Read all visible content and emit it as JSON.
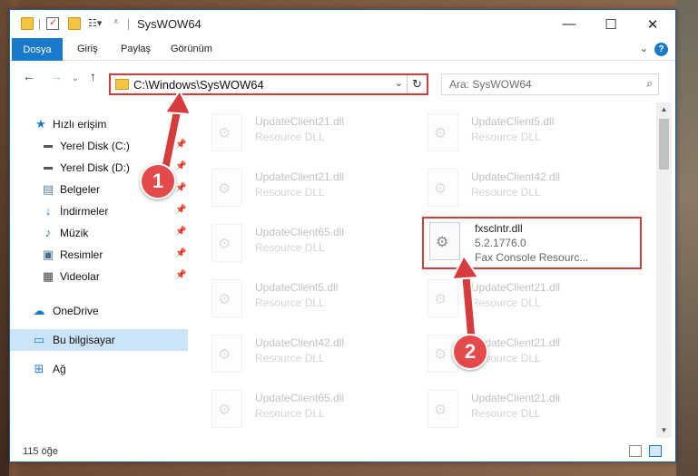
{
  "window": {
    "title": "SysWOW64",
    "minimize_glyph": "—",
    "maximize_glyph": "☐",
    "close_glyph": "✕"
  },
  "ribbon": {
    "file_tab": "Dosya",
    "tabs": [
      "Giriş",
      "Paylaş",
      "Görünüm"
    ],
    "help_glyph": "?"
  },
  "address": {
    "path": "C:\\Windows\\SysWOW64",
    "search_placeholder": "Ara: SysWOW64"
  },
  "nav": {
    "quick_access": "Hızlı erişim",
    "items": [
      {
        "label": "Yerel Disk (C:)",
        "icon": "drive-icon"
      },
      {
        "label": "Yerel Disk (D:)",
        "icon": "drive-icon"
      },
      {
        "label": "Belgeler",
        "icon": "documents-icon"
      },
      {
        "label": "İndirmeler",
        "icon": "downloads-icon"
      },
      {
        "label": "Müzik",
        "icon": "music-icon"
      },
      {
        "label": "Resimler",
        "icon": "pictures-icon"
      },
      {
        "label": "Videolar",
        "icon": "videos-icon"
      }
    ],
    "onedrive": "OneDrive",
    "this_pc": "Bu bilgisayar",
    "network": "Ağ"
  },
  "files": {
    "left": [
      {
        "name": "UpdateClient21.dll",
        "type": "Resource DLL"
      },
      {
        "name": "UpdateClient21.dll",
        "type": "Resource DLL"
      },
      {
        "name": "UpdateClient65.dll",
        "type": "Resource DLL"
      },
      {
        "name": "UpdateClient5.dll",
        "type": "Resource DLL"
      },
      {
        "name": "UpdateClient42.dll",
        "type": "Resource DLL"
      },
      {
        "name": "UpdateClient65.dll",
        "type": "Resource DLL"
      }
    ],
    "right": [
      {
        "name": "UpdateClient5.dll",
        "type": "Resource DLL"
      },
      {
        "name": "UpdateClient42.dll",
        "type": "Resource DLL"
      },
      {
        "name": "UpdateClient21.dll",
        "type": "Resource DLL"
      },
      {
        "name": "UpdateClient21.dll",
        "type": "Resource DLL"
      },
      {
        "name": "UpdateClient21.dll",
        "type": "Resource DLL"
      }
    ],
    "highlighted": {
      "name": "fxsclntr.dll",
      "version": "5.2.1776.0",
      "description": "Fax Console Resourc..."
    }
  },
  "status": {
    "item_count": "115 öğe"
  },
  "annotations": {
    "step1": "1",
    "step2": "2",
    "color": "#d63c3c"
  }
}
